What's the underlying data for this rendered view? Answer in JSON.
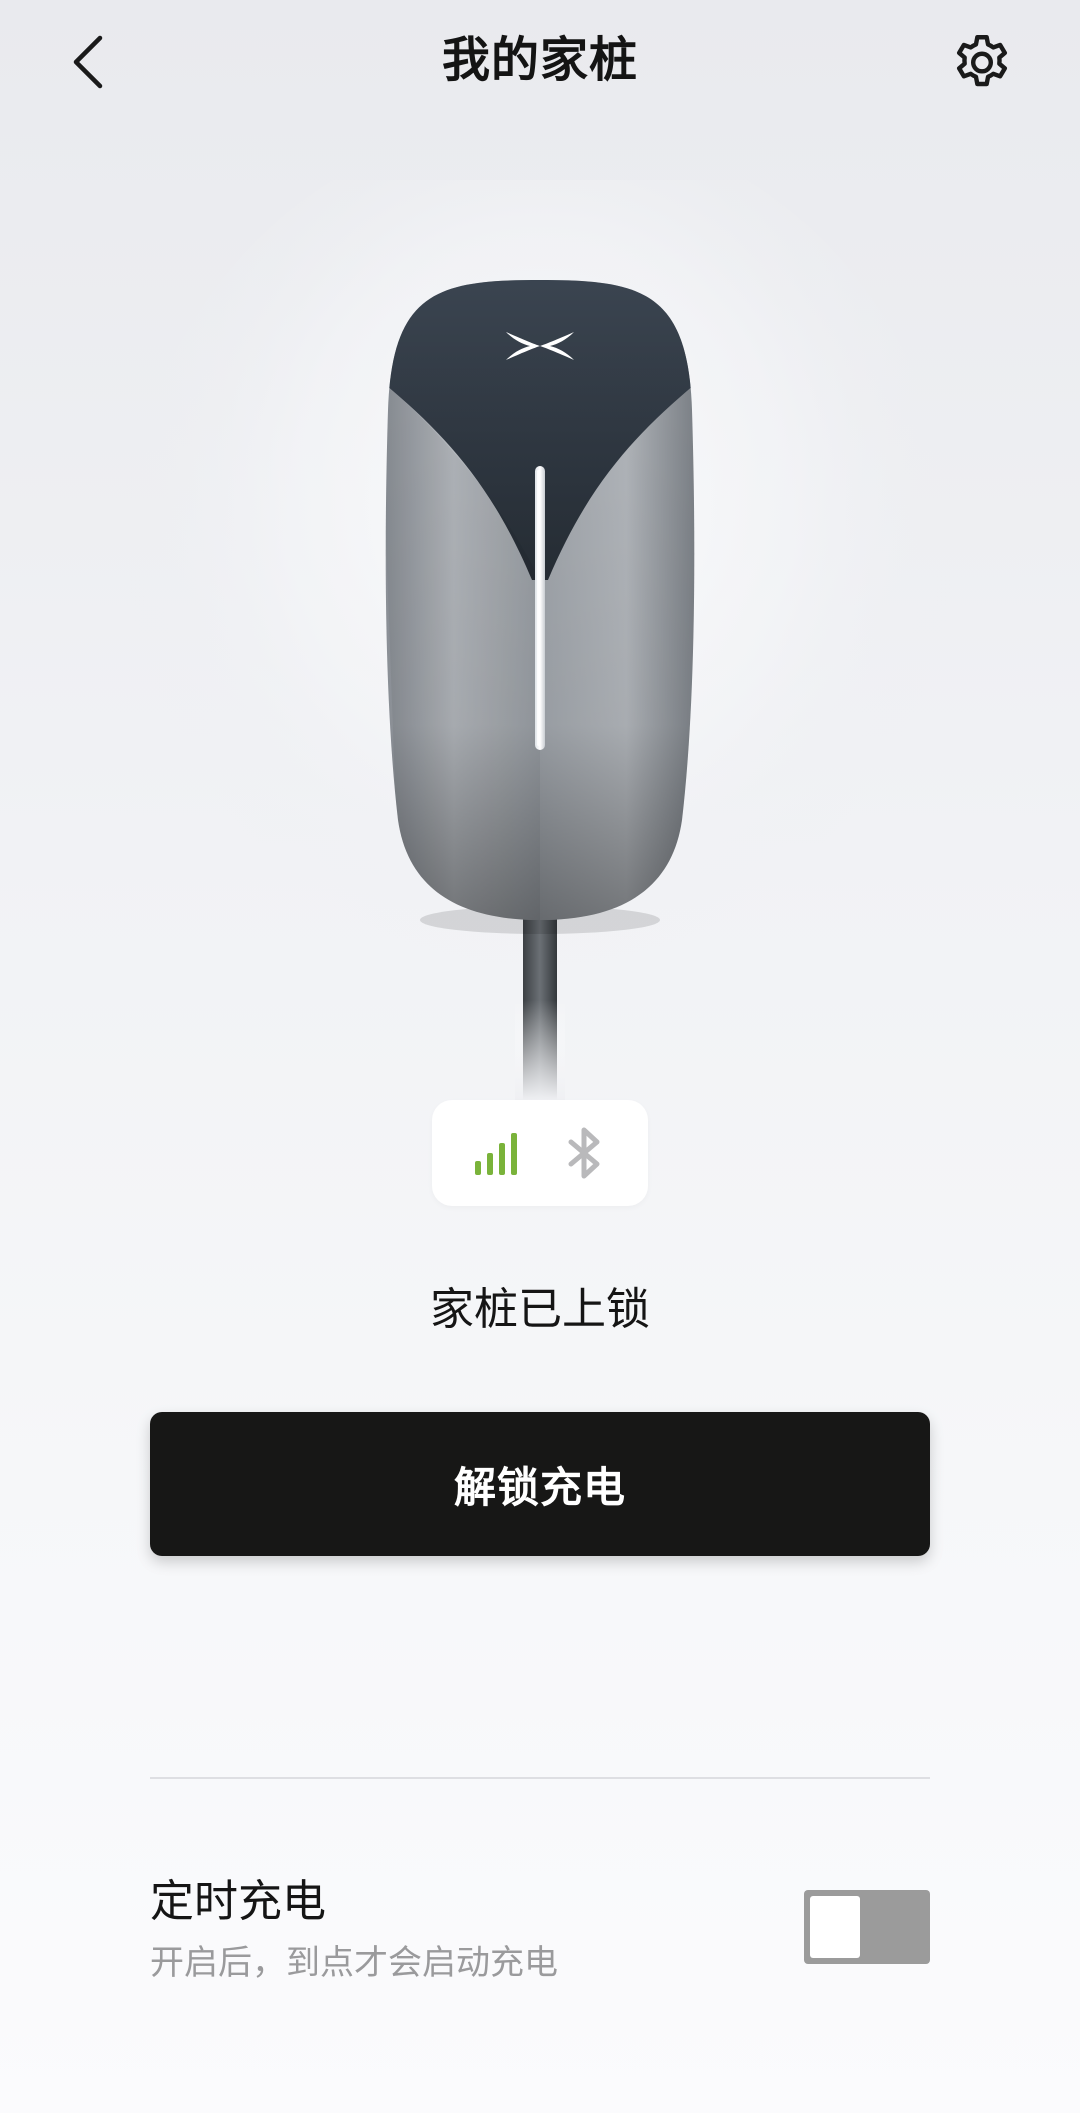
{
  "header": {
    "title": "我的家桩",
    "back_icon": "chevron-left-icon",
    "settings_icon": "gear-icon"
  },
  "device": {
    "logo_icon": "xpeng-x-logo",
    "signal_icon": "signal-bars-icon",
    "signal_color": "#7ab33a",
    "bluetooth_icon": "bluetooth-icon",
    "bluetooth_color": "#b9b9bb",
    "lock_status": "家桩已上锁"
  },
  "primary_action": {
    "label": "解锁充电",
    "color": "#171716"
  },
  "scheduled_charging": {
    "title": "定时充电",
    "subtitle": "开启后，到点才会启动充电",
    "enabled": false,
    "toggle_color": "#9b9b9b"
  }
}
